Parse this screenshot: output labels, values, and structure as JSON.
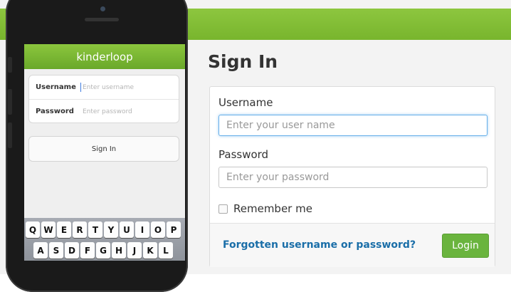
{
  "desktop": {
    "heading": "Sign In",
    "username_label": "Username",
    "username_placeholder": "Enter your user name",
    "password_label": "Password",
    "password_placeholder": "Enter your password",
    "remember_label": "Remember me",
    "forgot_link": "Forgotten username or password?",
    "login_button": "Login",
    "accent_color": "#78b52d",
    "link_color": "#1a6ea8"
  },
  "mobile": {
    "app_title": "kinderloop",
    "username_label": "Username",
    "username_placeholder": "Enter username",
    "password_label": "Password",
    "password_placeholder": "Enter password",
    "signin_button": "Sign In",
    "keyboard_row1": [
      "Q",
      "W",
      "E",
      "R",
      "T",
      "Y",
      "U",
      "I",
      "O",
      "P"
    ],
    "keyboard_row2": [
      "A",
      "S",
      "D",
      "F",
      "G",
      "H",
      "J",
      "K",
      "L"
    ]
  }
}
